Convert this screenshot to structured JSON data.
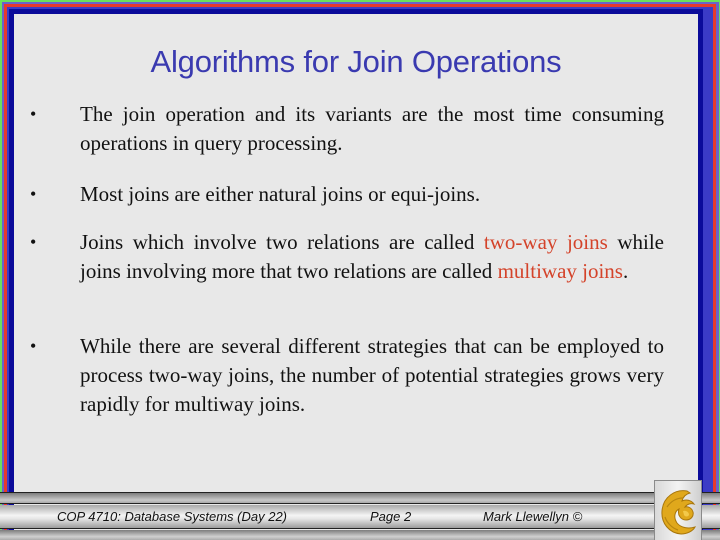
{
  "slide": {
    "title": "Algorithms for Join Operations",
    "bullet_glyph": "•",
    "bullets": [
      {
        "parts": [
          {
            "text": "The join operation and its variants are the most time consuming operations in query processing.",
            "highlight": false
          }
        ]
      },
      {
        "parts": [
          {
            "text": "Most joins are either natural joins or equi-joins.",
            "highlight": false
          }
        ]
      },
      {
        "parts": [
          {
            "text": "Joins which involve two relations are called ",
            "highlight": false
          },
          {
            "text": "two-way joins",
            "highlight": true
          },
          {
            "text": " while joins involving more that two relations are called ",
            "highlight": false
          },
          {
            "text": "multiway joins",
            "highlight": true
          },
          {
            "text": ".",
            "highlight": false
          }
        ]
      },
      {
        "parts": [
          {
            "text": "While there are several different strategies that can be employed to process two-way joins, the number of potential strategies grows very rapidly for multiway joins.",
            "highlight": false
          }
        ]
      }
    ]
  },
  "footer": {
    "course": "COP 4710: Database Systems  (Day 22)",
    "page": "Page 2",
    "author": "Mark Llewellyn ©",
    "logo_icon": "pegasus-logo-icon"
  },
  "colors": {
    "title": "#3a3ab0",
    "highlight": "#d4432a",
    "body_text": "#111111",
    "background": "#e8e8e8",
    "logo_gold": "#e0a81c"
  }
}
